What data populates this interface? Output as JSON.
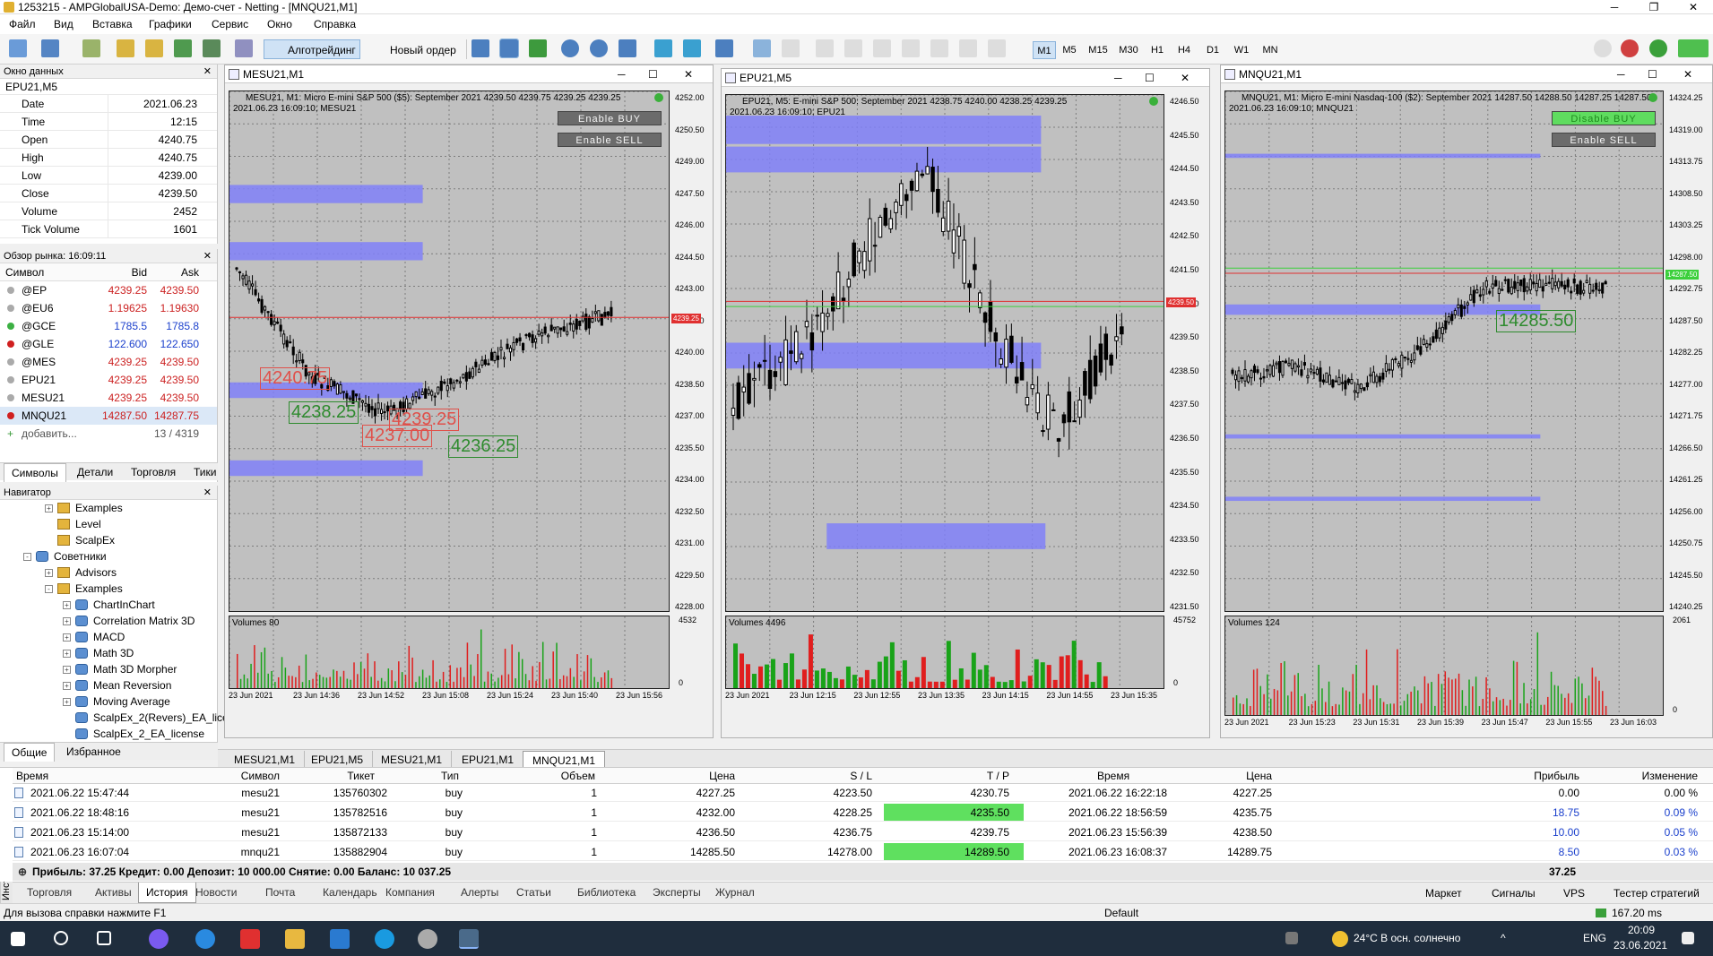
{
  "window": {
    "title": "1253215 - AMPGlobalUSA-Demo: Демо-счет - Netting - [MNQU21,M1]"
  },
  "menu": [
    "Файл",
    "Вид",
    "Вставка",
    "Графики",
    "Сервис",
    "Окно",
    "Справка"
  ],
  "toolbar": {
    "algo": "Алготрейдинг",
    "new_order": "Новый ордер",
    "timeframes": [
      "M1",
      "M5",
      "M15",
      "M30",
      "H1",
      "H4",
      "D1",
      "W1",
      "MN"
    ],
    "active_tf": "M1"
  },
  "data_window": {
    "title": "Окно данных",
    "symbol": "EPU21,M5",
    "rows": [
      {
        "k": "Date",
        "v": "2021.06.23"
      },
      {
        "k": "Time",
        "v": "12:15"
      },
      {
        "k": "Open",
        "v": "4240.75"
      },
      {
        "k": "High",
        "v": "4240.75"
      },
      {
        "k": "Low",
        "v": "4239.00"
      },
      {
        "k": "Close",
        "v": "4239.50"
      },
      {
        "k": "Volume",
        "v": "2452"
      },
      {
        "k": "Tick Volume",
        "v": "1601"
      }
    ]
  },
  "market_watch": {
    "title": "Обзор рынка: 16:09:11",
    "cols": {
      "symbol": "Символ",
      "bid": "Bid",
      "ask": "Ask"
    },
    "rows": [
      {
        "s": "@EP",
        "b": "4239.25",
        "a": "4239.50",
        "c": "#cc2222",
        "ic": "#aaaaaa"
      },
      {
        "s": "@EU6",
        "b": "1.19625",
        "a": "1.19630",
        "c": "#cc2222",
        "ic": "#aaaaaa"
      },
      {
        "s": "@GCE",
        "b": "1785.5",
        "a": "1785.8",
        "c": "#1a3fcc",
        "ic": "#3cb043"
      },
      {
        "s": "@GLE",
        "b": "122.600",
        "a": "122.650",
        "c": "#1a3fcc",
        "ic": "#d02020"
      },
      {
        "s": "@MES",
        "b": "4239.25",
        "a": "4239.50",
        "c": "#cc2222",
        "ic": "#aaaaaa"
      },
      {
        "s": "EPU21",
        "b": "4239.25",
        "a": "4239.50",
        "c": "#cc2222",
        "ic": "#aaaaaa"
      },
      {
        "s": "MESU21",
        "b": "4239.25",
        "a": "4239.50",
        "c": "#cc2222",
        "ic": "#aaaaaa"
      },
      {
        "s": "MNQU21",
        "b": "14287.50",
        "a": "14287.75",
        "c": "#cc2222",
        "ic": "#d02020"
      }
    ],
    "add": "добавить...",
    "count": "13 / 4319",
    "tabs": [
      "Символы",
      "Детали",
      "Торговля",
      "Тики"
    ]
  },
  "navigator": {
    "title": "Навигатор",
    "items": [
      {
        "label": "Examples",
        "lvl": 2,
        "type": "folder",
        "pm": "+"
      },
      {
        "label": "Level",
        "lvl": 2,
        "type": "folder",
        "pm": ""
      },
      {
        "label": "ScalpEx",
        "lvl": 2,
        "type": "folder",
        "pm": ""
      },
      {
        "label": "Советники",
        "lvl": 1,
        "type": "robot",
        "pm": "-"
      },
      {
        "label": "Advisors",
        "lvl": 2,
        "type": "folder",
        "pm": "+"
      },
      {
        "label": "Examples",
        "lvl": 2,
        "type": "folder",
        "pm": "-"
      },
      {
        "label": "ChartInChart",
        "lvl": 3,
        "type": "robot",
        "pm": "+"
      },
      {
        "label": "Correlation Matrix 3D",
        "lvl": 3,
        "type": "robot",
        "pm": "+"
      },
      {
        "label": "MACD",
        "lvl": 3,
        "type": "robot",
        "pm": "+"
      },
      {
        "label": "Math 3D",
        "lvl": 3,
        "type": "robot",
        "pm": "+"
      },
      {
        "label": "Math 3D Morpher",
        "lvl": 3,
        "type": "robot",
        "pm": "+"
      },
      {
        "label": "Mean Reversion",
        "lvl": 3,
        "type": "robot",
        "pm": "+"
      },
      {
        "label": "Moving Average",
        "lvl": 3,
        "type": "robot",
        "pm": "+"
      },
      {
        "label": "ScalpEx_2(Revers)_EA_lice",
        "lvl": 3,
        "type": "robot",
        "pm": ""
      },
      {
        "label": "ScalpEx_2_EA_license",
        "lvl": 3,
        "type": "robot",
        "pm": ""
      }
    ],
    "tabs": [
      "Общие",
      "Избранное"
    ]
  },
  "charts": [
    {
      "win": "MESU21,M1",
      "info": "MESU21, M1:  Micro E-mini S&P 500 ($5): September 2021  4239.50 4239.75 4239.25 4239.25",
      "time": "2021.06.23 16:09:10; MESU21",
      "btn1": "Enable BUY",
      "btn2": "Enable SELL",
      "btn1_on": false,
      "y": [
        "4252.00",
        "4250.50",
        "4249.00",
        "4247.50",
        "4246.00",
        "4244.50",
        "4243.00",
        "4241.50",
        "4240.00",
        "4238.50",
        "4237.00",
        "4235.50",
        "4234.00",
        "4232.50",
        "4231.00",
        "4229.50",
        "4228.00"
      ],
      "price_tag": "4239.25",
      "vol": "Volumes 80",
      "vmax": "4532",
      "vmin": "0",
      "x": [
        "23 Jun 2021",
        "23 Jun 14:36",
        "23 Jun 14:52",
        "23 Jun 15:08",
        "23 Jun 15:24",
        "23 Jun 15:40",
        "23 Jun 15:56"
      ],
      "labels": [
        {
          "t": "4240.75",
          "c": "#e0504a"
        },
        {
          "t": "4238.25",
          "c": "#2e8b2e"
        },
        {
          "t": "4239.25",
          "c": "#e0504a"
        },
        {
          "t": "4237.00",
          "c": "#e0504a"
        },
        {
          "t": "4236.25",
          "c": "#2e8b2e"
        }
      ]
    },
    {
      "win": "EPU21,M5",
      "info": "EPU21, M5:  E-mini S&P 500: September 2021  4238.75 4240.00 4238.25 4239.25",
      "time": "2021.06.23 16:09:10; EPU21",
      "y": [
        "4246.50",
        "4245.50",
        "4244.50",
        "4243.50",
        "4242.50",
        "4241.50",
        "4240.50",
        "4239.50",
        "4238.50",
        "4237.50",
        "4236.50",
        "4235.50",
        "4234.50",
        "4233.50",
        "4232.50",
        "4231.50"
      ],
      "price_tag": "4239.50",
      "vol": "Volumes 4496",
      "vmax": "45752",
      "vmin": "0",
      "x": [
        "23 Jun 2021",
        "23 Jun 12:15",
        "23 Jun 12:55",
        "23 Jun 13:35",
        "23 Jun 14:15",
        "23 Jun 14:55",
        "23 Jun 15:35"
      ]
    },
    {
      "win": "MNQU21,M1",
      "info": "MNQU21, M1:  Micro E-mini Nasdaq-100 ($2): September 2021  14287.50 14288.50 14287.25 14287.50",
      "time": "2021.06.23 16:09:10; MNQU21",
      "btn1": "Disable BUY",
      "btn2": "Enable SELL",
      "btn1_on": true,
      "y": [
        "14324.25",
        "14319.00",
        "14313.75",
        "14308.50",
        "14303.25",
        "14298.00",
        "14292.75",
        "14287.50",
        "14282.25",
        "14277.00",
        "14271.75",
        "14266.50",
        "14261.25",
        "14256.00",
        "14250.75",
        "14245.50",
        "14240.25"
      ],
      "price_tag": "14287.50",
      "vol": "Volumes 124",
      "vmax": "2061",
      "vmin": "0",
      "label": "14285.50",
      "x": [
        "23 Jun 2021",
        "23 Jun 15:23",
        "23 Jun 15:31",
        "23 Jun 15:39",
        "23 Jun 15:47",
        "23 Jun 15:55",
        "23 Jun 16:03"
      ]
    }
  ],
  "chart_tabs": [
    "MESU21,M1",
    "EPU21,M5",
    "MESU21,M1",
    "EPU21,M1",
    "MNQU21,M1"
  ],
  "history": {
    "cols": [
      "Время",
      "Символ",
      "Тикет",
      "Тип",
      "Объем",
      "Цена",
      "S / L",
      "T / P",
      "Время",
      "Цена",
      "Прибыль",
      "Изменение"
    ],
    "rows": [
      [
        "2021.06.22 15:47:44",
        "mesu21",
        "135760302",
        "buy",
        "1",
        "4227.25",
        "4223.50",
        "4230.75",
        "2021.06.22 16:22:18",
        "4227.25",
        "0.00",
        "0.00 %"
      ],
      [
        "2021.06.22 18:48:16",
        "mesu21",
        "135782516",
        "buy",
        "1",
        "4232.00",
        "4228.25",
        "4235.50",
        "2021.06.22 18:56:59",
        "4235.75",
        "18.75",
        "0.09 %"
      ],
      [
        "2021.06.23 15:14:00",
        "mesu21",
        "135872133",
        "buy",
        "1",
        "4236.50",
        "4236.75",
        "4239.75",
        "2021.06.23 15:56:39",
        "4238.50",
        "10.00",
        "0.05 %"
      ],
      [
        "2021.06.23 16:07:04",
        "mnqu21",
        "135882904",
        "buy",
        "1",
        "14285.50",
        "14278.00",
        "14289.50",
        "2021.06.23 16:08:37",
        "14289.75",
        "8.50",
        "0.03 %"
      ]
    ],
    "tp_hit": [
      false,
      true,
      false,
      true
    ],
    "summary": "Прибыль: 37.25  Кредит: 0.00  Депозит: 10 000.00  Снятие: 0.00  Баланс: 10 037.25",
    "total": "37.25"
  },
  "terminal_tabs": [
    "Торговля",
    "Активы",
    "История",
    "Новости",
    "Почта",
    "Календарь",
    "Компания",
    "Алерты",
    "Статьи",
    "Библиотека",
    "Эксперты",
    "Журнал"
  ],
  "terminal_active": "История",
  "terminal_right": [
    "Маркет",
    "Сигналы",
    "VPS",
    "Тестер стратегий"
  ],
  "side_label": "Инструменты",
  "status": {
    "help": "Для вызова справки нажмите F1",
    "profile": "Default",
    "ping": "167.20 ms"
  },
  "taskbar": {
    "weather": "24°C  В осн. солнечно",
    "lang": "ENG",
    "time": "20:09",
    "date": "23.06.2021"
  }
}
